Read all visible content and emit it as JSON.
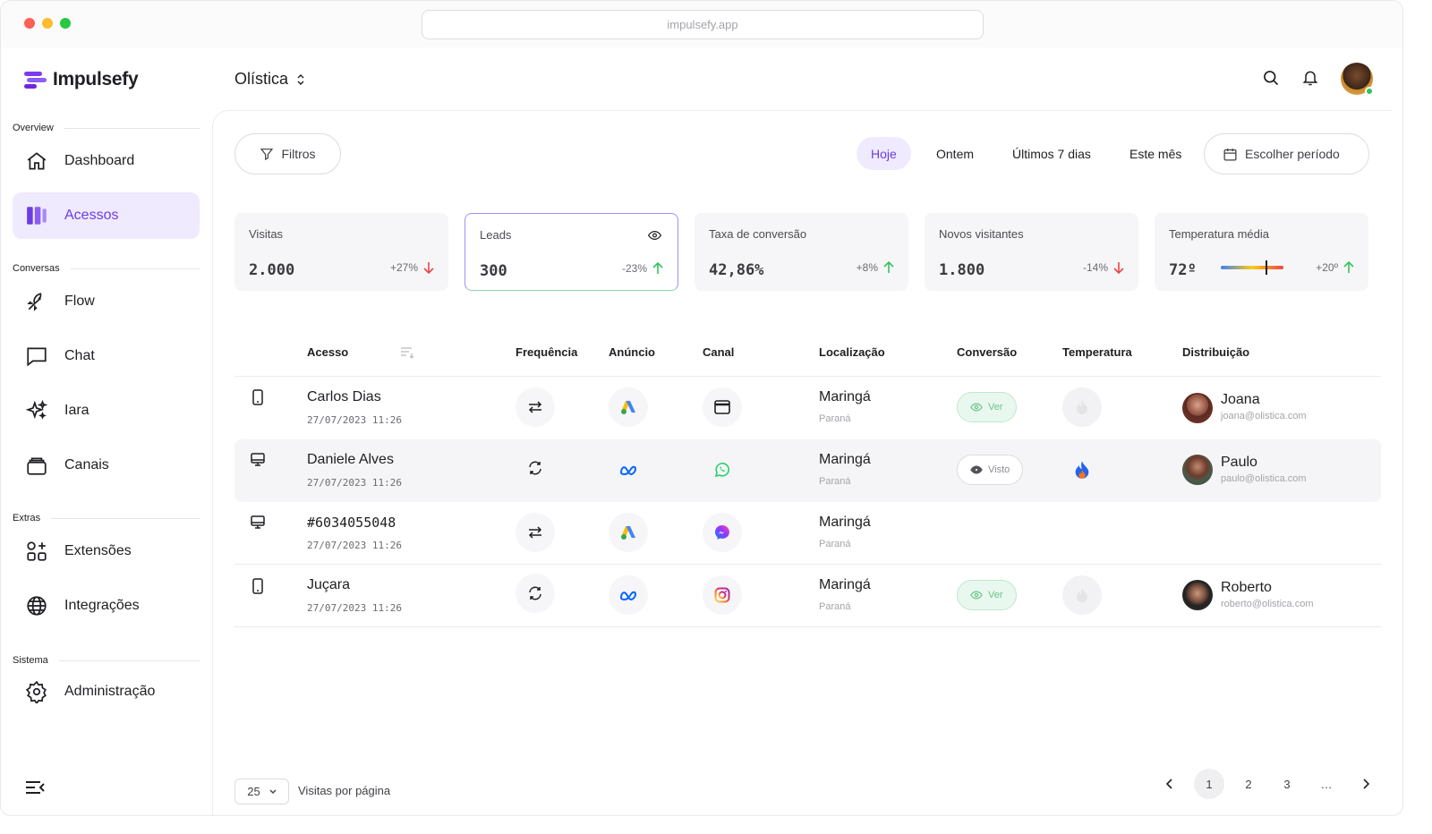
{
  "browser": {
    "url": "impulsefy.app"
  },
  "app": {
    "name": "Impulsefy"
  },
  "sidebar": {
    "sections": [
      {
        "title": "Overview"
      },
      {
        "title": "Conversas"
      },
      {
        "title": "Extras"
      },
      {
        "title": "Sistema"
      }
    ],
    "items": [
      {
        "label": "Dashboard",
        "icon": "home-icon"
      },
      {
        "label": "Acessos",
        "icon": "columns-icon",
        "active": true
      },
      {
        "label": "Flow",
        "icon": "flow-icon"
      },
      {
        "label": "Chat",
        "icon": "chat-icon"
      },
      {
        "label": "Iara",
        "icon": "sparkles-icon"
      },
      {
        "label": "Canais",
        "icon": "layers-icon"
      },
      {
        "label": "Extensões",
        "icon": "extensions-icon"
      },
      {
        "label": "Integrações",
        "icon": "globe-icon"
      },
      {
        "label": "Administração",
        "icon": "gear-icon"
      }
    ]
  },
  "header": {
    "org": "Olística"
  },
  "toolbar": {
    "filters_label": "Filtros",
    "ranges": [
      "Hoje",
      "Ontem",
      "Últimos 7 dias",
      "Este mês"
    ],
    "active_range": "Hoje",
    "period_label": "Escolher período"
  },
  "stats": [
    {
      "label": "Visitas",
      "value": "2.000",
      "change": "+27%",
      "trend": "down"
    },
    {
      "label": "Leads",
      "value": "300",
      "change": "-23%",
      "trend": "up",
      "selected": true
    },
    {
      "label": "Taxa de conversão",
      "value": "42,86%",
      "change": "+8%",
      "trend": "up"
    },
    {
      "label": "Novos visitantes",
      "value": "1.800",
      "change": "-14%",
      "trend": "down"
    },
    {
      "label": "Temperatura média",
      "value": "72º",
      "change": "+20º",
      "trend": "up",
      "gauge": 0.72
    }
  ],
  "table": {
    "columns": [
      "Acesso",
      "Frequência",
      "Anúncio",
      "Canal",
      "Localização",
      "Conversão",
      "Temperatura",
      "Distribuição"
    ],
    "rows": [
      {
        "device": "phone-icon",
        "name": "Carlos Dias",
        "date": "27/07/2023 11:26",
        "frequency": "swap-icon",
        "ad": "google-ads-icon",
        "channel": "browser-icon",
        "city": "Maringá",
        "state": "Paraná",
        "conversion": "Ver",
        "temperature": "cold",
        "person": "Joana",
        "email": "joana@olistica.com"
      },
      {
        "device": "desktop-icon",
        "name": "Daniele Alves",
        "date": "27/07/2023 11:26",
        "frequency": "refresh-icon",
        "ad": "meta-icon",
        "channel": "whatsapp-icon",
        "city": "Maringá",
        "state": "Paraná",
        "conversion": "Visto",
        "temperature": "hot",
        "person": "Paulo",
        "email": "paulo@olistica.com"
      },
      {
        "device": "desktop-icon",
        "name": "#6034055048",
        "date": "27/07/2023 11:26",
        "frequency": "swap-icon",
        "ad": "google-ads-icon",
        "channel": "messenger-icon",
        "city": "Maringá",
        "state": "Paraná",
        "conversion": "",
        "temperature": "",
        "person": "",
        "email": ""
      },
      {
        "device": "phone-icon",
        "name": "Juçara",
        "date": "27/07/2023 11:26",
        "frequency": "refresh-icon",
        "ad": "meta-icon",
        "channel": "instagram-icon",
        "city": "Maringá",
        "state": "Paraná",
        "conversion": "Ver",
        "temperature": "cold",
        "person": "Roberto",
        "email": "roberto@olistica.com"
      }
    ]
  },
  "pagination": {
    "per_page": "25",
    "per_page_label": "Visitas por página",
    "pages": [
      "1",
      "2",
      "3",
      "…"
    ],
    "current": "1"
  },
  "colors": {
    "accent": "#6c3be6",
    "accent_bg": "#efeafd",
    "up": "#34c35b",
    "down": "#ef4444"
  }
}
